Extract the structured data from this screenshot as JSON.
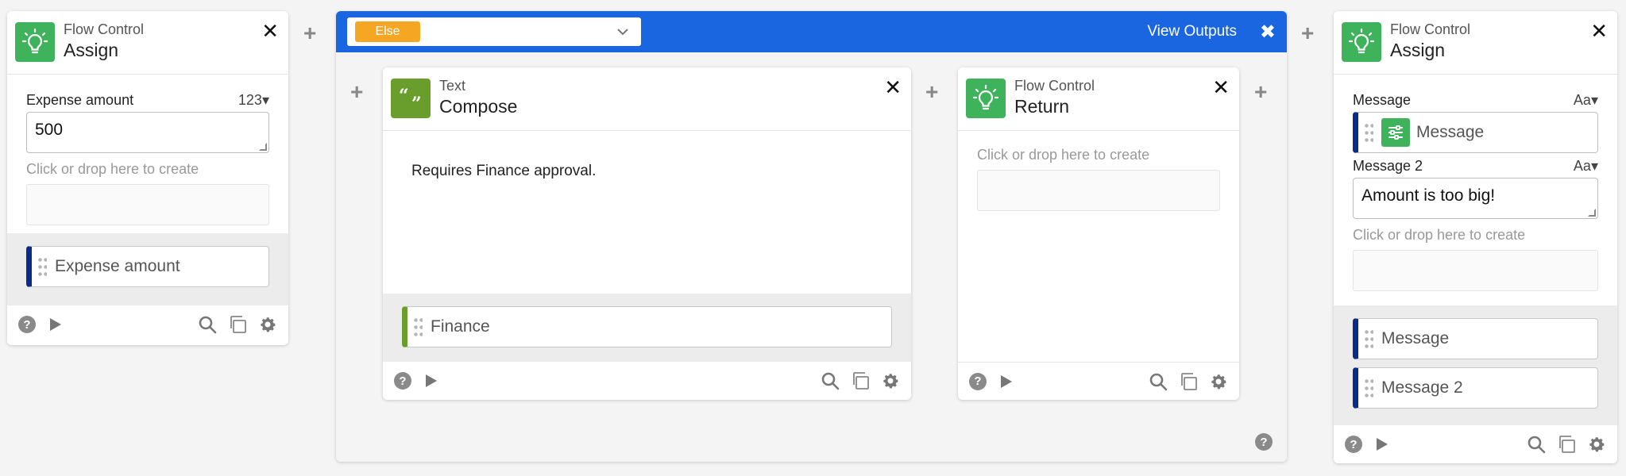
{
  "left_card": {
    "category": "Flow Control",
    "title": "Assign",
    "field_label": "Expense amount",
    "field_type": "123",
    "field_value": "500",
    "drop_hint": "Click or drop here to create",
    "output": "Expense amount"
  },
  "container": {
    "branch_label": "Else",
    "view_outputs": "View Outputs"
  },
  "compose_card": {
    "category": "Text",
    "title": "Compose",
    "content": "Requires Finance approval.",
    "output": "Finance"
  },
  "return_card": {
    "category": "Flow Control",
    "title": "Return",
    "drop_hint": "Click or drop here to create"
  },
  "right_card": {
    "category": "Flow Control",
    "title": "Assign",
    "field1_label": "Message",
    "field1_type": "Aa",
    "field1_value": "Message",
    "field2_label": "Message 2",
    "field2_type": "Aa",
    "field2_value": "Amount is too big!",
    "drop_hint": "Click or drop here to create",
    "output1": "Message",
    "output2": "Message 2"
  },
  "colors": {
    "accent_blue": "#1a66e0",
    "flow_green": "#3eb35c",
    "text_green": "#6a9e2c",
    "else_orange": "#f5a623",
    "pill_navy": "#0a2b86"
  }
}
